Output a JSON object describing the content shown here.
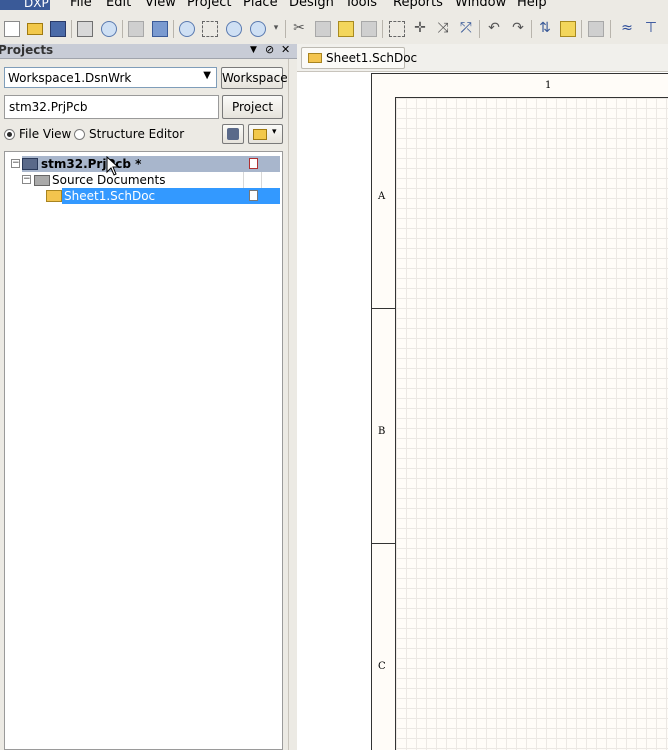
{
  "menu": {
    "app": "DXP",
    "items": [
      "File",
      "Edit",
      "View",
      "Project",
      "Place",
      "Design",
      "Tools",
      "Reports",
      "Window",
      "Help"
    ]
  },
  "toolbar": {
    "icons": [
      "new-file-icon",
      "open-folder-icon",
      "save-icon",
      "print-icon",
      "print-preview-icon",
      "layers-icon",
      "chip-icon",
      "zoom-fit-icon",
      "zoom-area-icon",
      "zoom-select-icon",
      "zoom-dropdown-icon",
      "cut-icon",
      "copy-icon",
      "paste-icon",
      "rubber-stamp-icon",
      "select-area-icon",
      "move-icon",
      "cross-select-icon",
      "clear-filter-icon",
      "undo-icon",
      "redo-icon",
      "hierarchy-icon",
      "cross-probe-icon",
      "browse-library-icon",
      "wire-icon",
      "bus-icon"
    ]
  },
  "projects_panel": {
    "title": "Projects",
    "workspace_value": "Workspace1.DsnWrk",
    "workspace_button": "Workspace",
    "project_value": "stm32.PrjPcb",
    "project_button": "Project",
    "radio_file_view": "File View",
    "radio_structure": "Structure Editor",
    "tree": {
      "project": "stm32.PrjPcb *",
      "folder": "Source Documents",
      "document": "Sheet1.SchDoc"
    }
  },
  "document": {
    "tab": "Sheet1.SchDoc",
    "column_label": "1",
    "zones": [
      "A",
      "B",
      "C"
    ]
  }
}
